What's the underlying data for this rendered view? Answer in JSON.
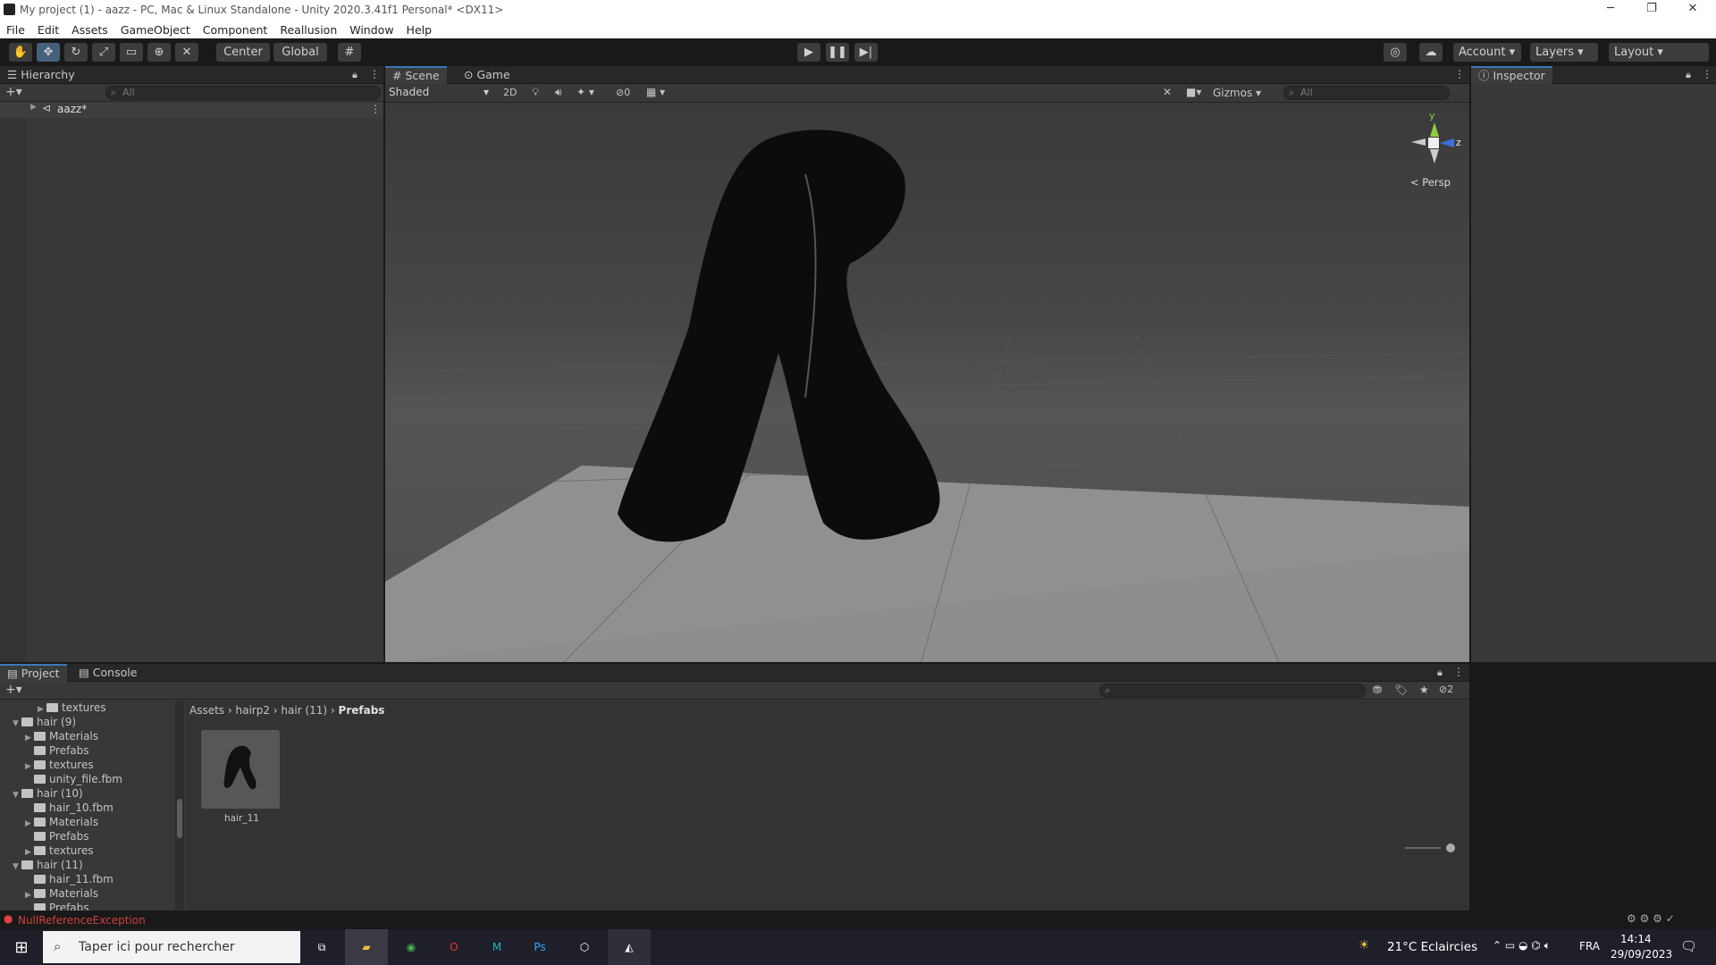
{
  "window": {
    "title": "My project (1) - aazz - PC, Mac & Linux Standalone - Unity 2020.3.41f1 Personal* <DX11>",
    "minimize": "─",
    "restore": "❐",
    "close": "✕"
  },
  "menu": [
    "File",
    "Edit",
    "Assets",
    "GameObject",
    "Component",
    "Reallusion",
    "Window",
    "Help"
  ],
  "toolbar": {
    "center": "Center",
    "global": "Global",
    "account": "Account",
    "layers": "Layers",
    "layout": "Layout"
  },
  "hierarchy": {
    "tab": "Hierarchy",
    "search_placeholder": "All",
    "scene_item": "aazz*"
  },
  "scene": {
    "tab_scene": "Scene",
    "tab_game": "Game",
    "shading": "Shaded",
    "mode2d": "2D",
    "hidden_count": "0",
    "gizmos": "Gizmos",
    "search_placeholder": "All",
    "persp": "< Persp",
    "axis_y": "y",
    "axis_z": "z"
  },
  "inspector": {
    "tab": "Inspector"
  },
  "project": {
    "tab_project": "Project",
    "tab_console": "Console",
    "badge": "2",
    "tree": [
      {
        "label": "textures",
        "indent": 3,
        "arrow": "▶"
      },
      {
        "label": "hair (9)",
        "indent": 1,
        "arrow": "▼"
      },
      {
        "label": "Materials",
        "indent": 2,
        "arrow": "▶"
      },
      {
        "label": "Prefabs",
        "indent": 2,
        "arrow": ""
      },
      {
        "label": "textures",
        "indent": 2,
        "arrow": "▶"
      },
      {
        "label": "unity_file.fbm",
        "indent": 2,
        "arrow": ""
      },
      {
        "label": "hair (10)",
        "indent": 1,
        "arrow": "▼"
      },
      {
        "label": "hair_10.fbm",
        "indent": 2,
        "arrow": ""
      },
      {
        "label": "Materials",
        "indent": 2,
        "arrow": "▶"
      },
      {
        "label": "Prefabs",
        "indent": 2,
        "arrow": ""
      },
      {
        "label": "textures",
        "indent": 2,
        "arrow": "▶"
      },
      {
        "label": "hair (11)",
        "indent": 1,
        "arrow": "▼"
      },
      {
        "label": "hair_11.fbm",
        "indent": 2,
        "arrow": ""
      },
      {
        "label": "Materials",
        "indent": 2,
        "arrow": "▶"
      },
      {
        "label": "Prefabs",
        "indent": 2,
        "arrow": ""
      }
    ],
    "breadcrumb": [
      "Assets",
      "hairp2",
      "hair (11)",
      "Prefabs"
    ],
    "asset_label": "hair_11"
  },
  "status": {
    "error": "NullReferenceException"
  },
  "taskbar": {
    "search": "Taper ici pour rechercher",
    "weather": "21°C  Eclaircies",
    "lang": "FRA",
    "time": "14:14",
    "date": "29/09/2023"
  }
}
